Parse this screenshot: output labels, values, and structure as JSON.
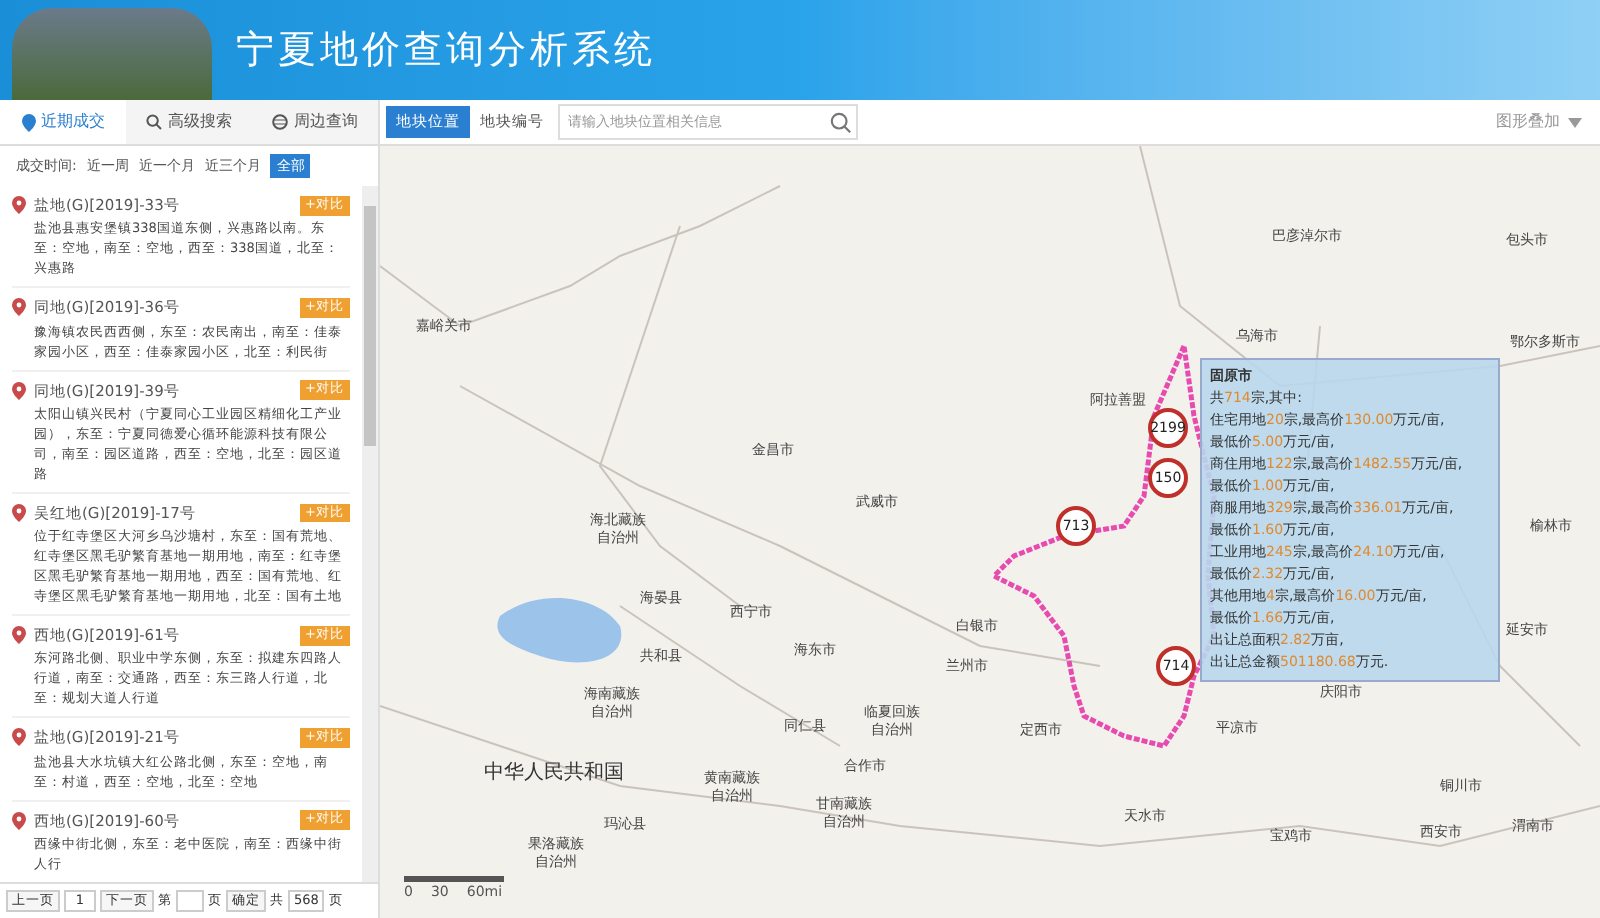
{
  "header": {
    "title": "宁夏地价查询分析系统"
  },
  "tabs": [
    {
      "label": "近期成交",
      "selected": true
    },
    {
      "label": "高级搜索",
      "selected": false
    },
    {
      "label": "周边查询",
      "selected": false
    }
  ],
  "search": {
    "modes": [
      {
        "label": "地块位置",
        "selected": true
      },
      {
        "label": "地块编号",
        "selected": false
      }
    ],
    "placeholder": "请输入地块位置相关信息"
  },
  "overlay_menu": {
    "label": "图形叠加"
  },
  "time_filter": {
    "label": "成交时间:",
    "options": [
      {
        "label": "近一周",
        "selected": false
      },
      {
        "label": "近一个月",
        "selected": false
      },
      {
        "label": "近三个月",
        "selected": false
      },
      {
        "label": "全部",
        "selected": true
      }
    ]
  },
  "transactions": [
    {
      "title": "盐地(G)[2019]-33号",
      "description": "盐池县惠安堡镇338国道东侧，兴惠路以南。东至：空地，南至：空地，西至：338国道，北至：兴惠路",
      "button": "+对比"
    },
    {
      "title": "同地(G)[2019]-36号",
      "description": "豫海镇农民西西侧，东至：农民南出，南至：佳泰家园小区，西至：佳泰家园小区，北至：利民街",
      "button": "+对比"
    },
    {
      "title": "同地(G)[2019]-39号",
      "description": "太阳山镇兴民村（宁夏同心工业园区精细化工产业园），东至：宁夏同德爱心循环能源科技有限公司，南至：园区道路，西至：空地，北至：园区道路",
      "button": "+对比"
    },
    {
      "title": "吴红地(G)[2019]-17号",
      "description": "位于红寺堡区大河乡乌沙塘村，东至：国有荒地、红寺堡区黑毛驴繁育基地一期用地，南至：红寺堡区黑毛驴繁育基地一期用地，西至：国有荒地、红寺堡区黑毛驴繁育基地一期用地，北至：国有土地",
      "button": "+对比"
    },
    {
      "title": "西地(G)[2019]-61号",
      "description": "东河路北侧、职业中学东侧，东至：拟建东四路人行道，南至：交通路，西至：东三路人行道，北至：规划大道人行道",
      "button": "+对比"
    },
    {
      "title": "盐地(G)[2019]-21号",
      "description": "盐池县大水坑镇大红公路北侧，东至：空地，南至：村道，西至：空地，北至：空地",
      "button": "+对比"
    },
    {
      "title": "西地(G)[2019]-60号",
      "description": "西缘中街北侧，东至：老中医院，南至：西缘中街人行",
      "button": "+对比"
    }
  ],
  "pagination": {
    "prev": "上一页",
    "current": "1",
    "next": "下一页",
    "goto_prefix": "第",
    "goto_suffix": "页",
    "confirm": "确定",
    "total_prefix": "共",
    "total": "568",
    "total_suffix": "页"
  },
  "map": {
    "labels": [
      "巴彦淖尔市",
      "包头市",
      "乌海市",
      "鄂尔多斯市",
      "嘉峪关市",
      "阿拉善盟",
      "金昌市",
      "武威市",
      "海北藏族自治州",
      "海晏县",
      "西宁市",
      "海东市",
      "白银市",
      "兰州市",
      "共和县",
      "海南藏族自治州",
      "同仁县",
      "临夏回族自治州",
      "定西市",
      "中华人民共和国",
      "黄南藏族自治州",
      "合作市",
      "玛沁县",
      "甘南藏族自治州",
      "果洛藏族自治州",
      "天水市",
      "宝鸡市",
      "西安市",
      "渭南市",
      "铜川市",
      "延安市",
      "庆阳市",
      "平凉市",
      "榆林市"
    ],
    "markers": [
      "2199",
      "150",
      "713",
      "714"
    ],
    "scale": [
      "0",
      "30",
      "60mi"
    ],
    "popup": {
      "title": "固原市",
      "lines": [
        [
          {
            "text": "共",
            "highlight": false
          },
          {
            "text": "714",
            "highlight": true
          },
          {
            "text": "宗,其中:",
            "highlight": false
          }
        ],
        [
          {
            "text": "住宅用地",
            "highlight": false
          },
          {
            "text": "20",
            "highlight": true
          },
          {
            "text": "宗,最高价",
            "highlight": false
          },
          {
            "text": "130.00",
            "highlight": true
          },
          {
            "text": "万元/亩,",
            "highlight": false
          }
        ],
        [
          {
            "text": "最低价",
            "highlight": false
          },
          {
            "text": "5.00",
            "highlight": true
          },
          {
            "text": "万元/亩,",
            "highlight": false
          }
        ],
        [
          {
            "text": "商住用地",
            "highlight": false
          },
          {
            "text": "122",
            "highlight": true
          },
          {
            "text": "宗,最高价",
            "highlight": false
          },
          {
            "text": "1482.55",
            "highlight": true
          },
          {
            "text": "万元/亩,",
            "highlight": false
          }
        ],
        [
          {
            "text": "最低价",
            "highlight": false
          },
          {
            "text": "1.00",
            "highlight": true
          },
          {
            "text": "万元/亩,",
            "highlight": false
          }
        ],
        [
          {
            "text": "商服用地",
            "highlight": false
          },
          {
            "text": "329",
            "highlight": true
          },
          {
            "text": "宗,最高价",
            "highlight": false
          },
          {
            "text": "336.01",
            "highlight": true
          },
          {
            "text": "万元/亩,",
            "highlight": false
          }
        ],
        [
          {
            "text": "最低价",
            "highlight": false
          },
          {
            "text": "1.60",
            "highlight": true
          },
          {
            "text": "万元/亩,",
            "highlight": false
          }
        ],
        [
          {
            "text": "工业用地",
            "highlight": false
          },
          {
            "text": "245",
            "highlight": true
          },
          {
            "text": "宗,最高价",
            "highlight": false
          },
          {
            "text": "24.10",
            "highlight": true
          },
          {
            "text": "万元/亩,",
            "highlight": false
          }
        ],
        [
          {
            "text": "最低价",
            "highlight": false
          },
          {
            "text": "2.32",
            "highlight": true
          },
          {
            "text": "万元/亩,",
            "highlight": false
          }
        ],
        [
          {
            "text": "其他用地",
            "highlight": false
          },
          {
            "text": "4",
            "highlight": true
          },
          {
            "text": "宗,最高价",
            "highlight": false
          },
          {
            "text": "16.00",
            "highlight": true
          },
          {
            "text": "万元/亩,",
            "highlight": false
          }
        ],
        [
          {
            "text": "最低价",
            "highlight": false
          },
          {
            "text": "1.66",
            "highlight": true
          },
          {
            "text": "万元/亩,",
            "highlight": false
          }
        ],
        [
          {
            "text": "出让总面积",
            "highlight": false
          },
          {
            "text": "2.82",
            "highlight": true
          },
          {
            "text": "万亩,",
            "highlight": false
          }
        ],
        [
          {
            "text": "出让总金额",
            "highlight": false
          },
          {
            "text": "501180.68",
            "highlight": true
          },
          {
            "text": "万元.",
            "highlight": false
          }
        ]
      ]
    }
  }
}
